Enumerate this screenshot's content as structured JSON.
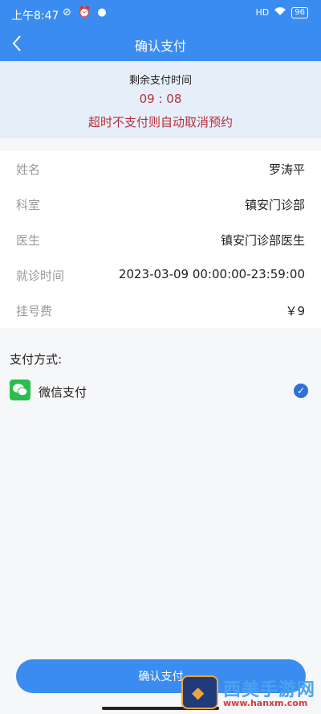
{
  "status_bar": {
    "time": "上午8:47",
    "left_icons": "⊘ ⏰ ●",
    "signal": "HD",
    "battery": "96"
  },
  "nav": {
    "title": "确认支付"
  },
  "countdown": {
    "label": "剩余支付时间",
    "time": "09 : 08",
    "warning": "超时不支付则自动取消预约"
  },
  "info_rows": [
    {
      "label": "姓名",
      "value": "罗涛平"
    },
    {
      "label": "科室",
      "value": "镇安门诊部"
    },
    {
      "label": "医生",
      "value": "镇安门诊部医生"
    },
    {
      "label": "就诊时间",
      "value": "2023-03-09 00:00:00-23:59:00"
    },
    {
      "label": "挂号费",
      "value": "￥9"
    }
  ],
  "payment": {
    "title": "支付方式:",
    "method": "微信支付",
    "method_icon": "wechat-icon",
    "selected": true
  },
  "confirm_button": "确认支付",
  "watermark": {
    "title": "西美手游网",
    "url": "www.hanxm.com"
  },
  "colors": {
    "primary": "#3b8cf0",
    "warning": "#b5323a",
    "countdown_bg": "#e6eef9",
    "wechat_green": "#2bbd4d"
  }
}
